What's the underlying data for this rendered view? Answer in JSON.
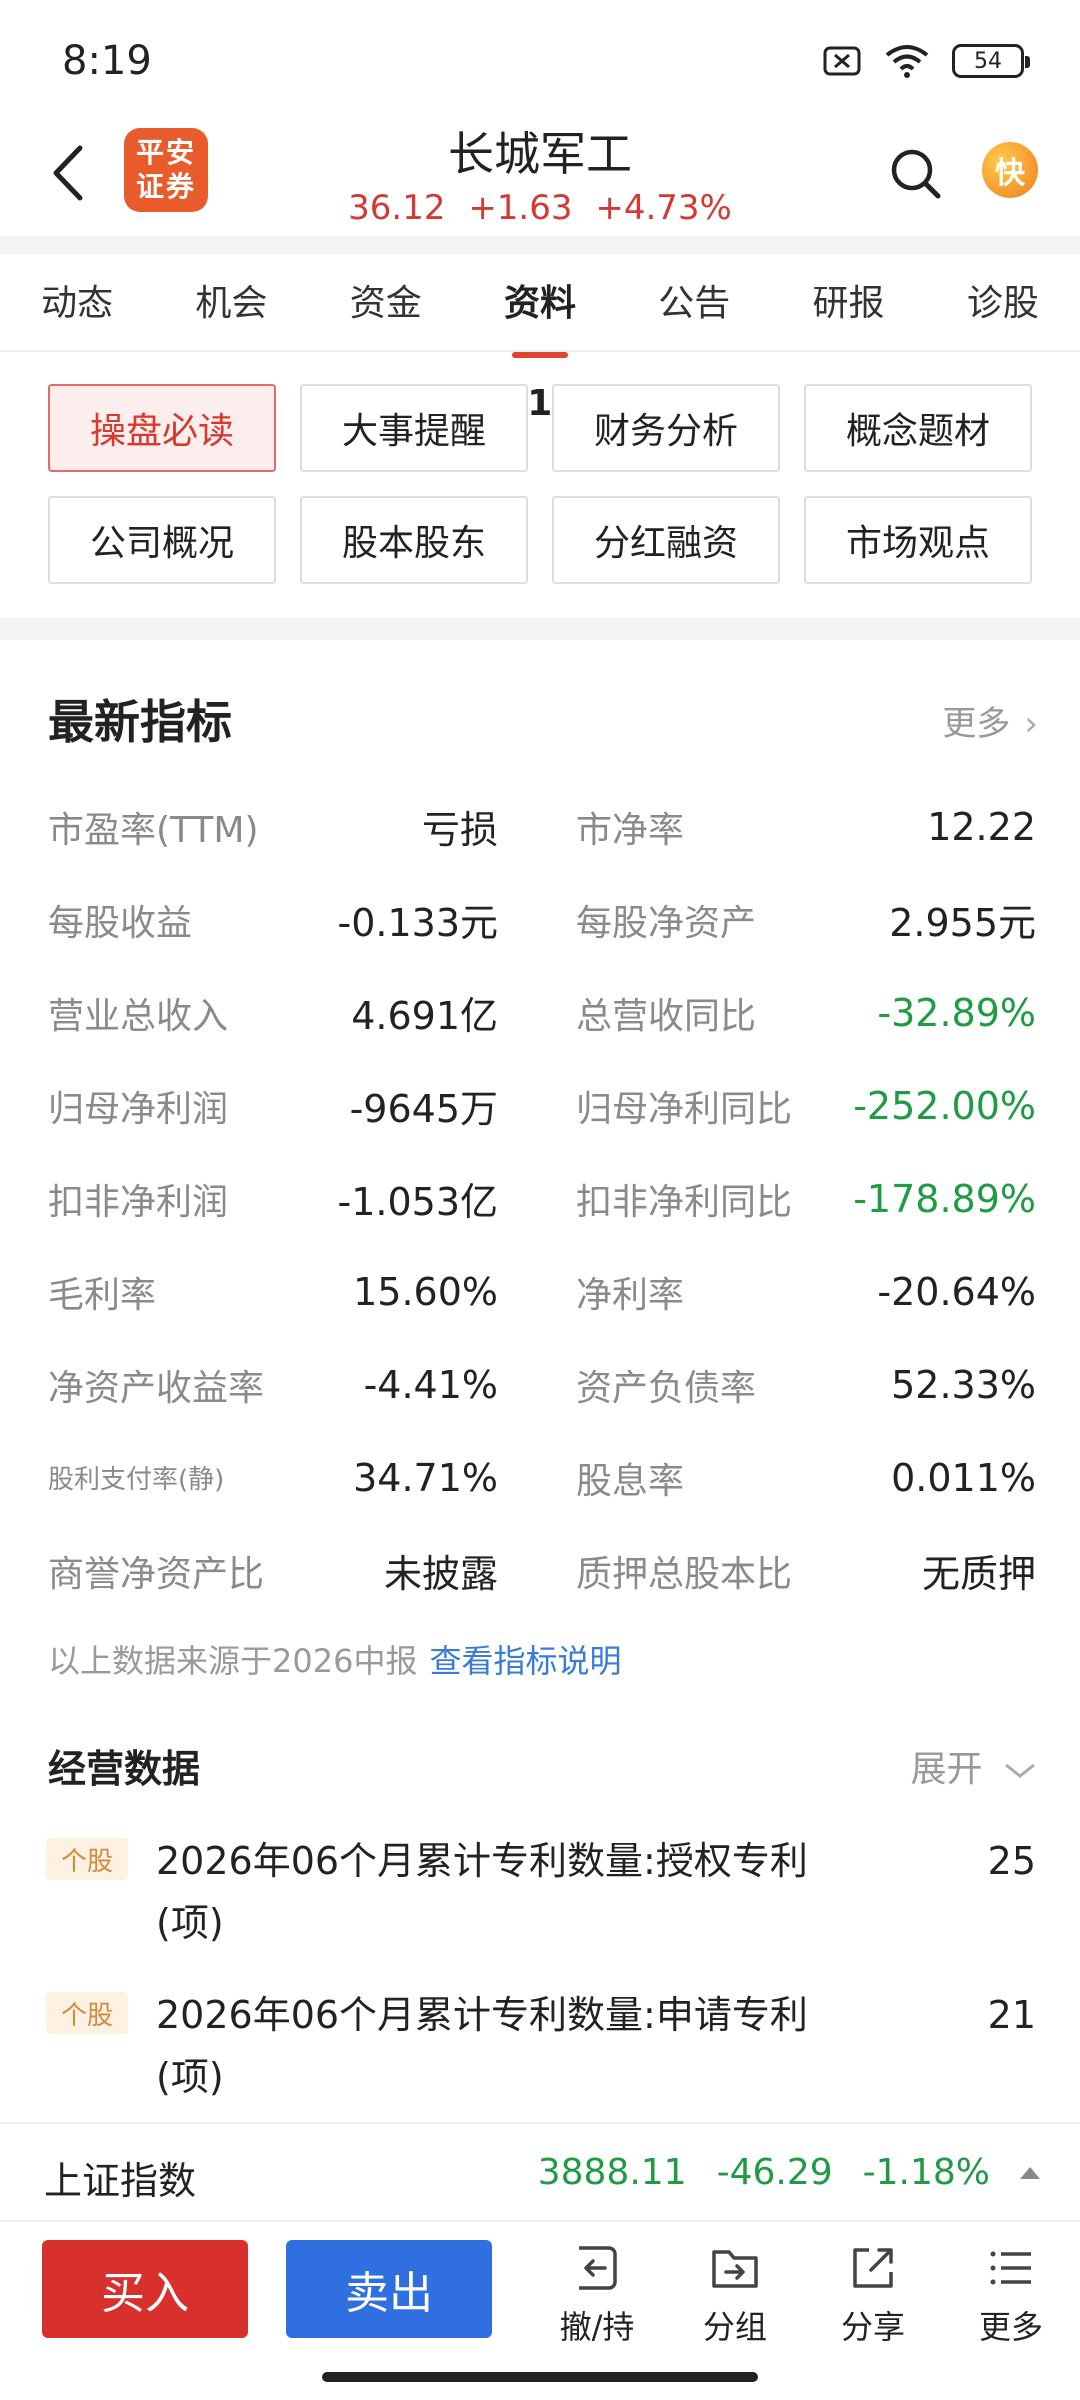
{
  "status_bar": {
    "time": "8:19",
    "battery": "54"
  },
  "header": {
    "brand_line1": "平安",
    "brand_line2": "证券",
    "stock_name": "长城军工",
    "price": "36.12",
    "change": "+1.63",
    "change_pct": "+4.73%",
    "kuai_label": "快"
  },
  "tabs": [
    {
      "label": "动态"
    },
    {
      "label": "机会"
    },
    {
      "label": "资金"
    },
    {
      "label": "资料(F10)",
      "active": true
    },
    {
      "label": "公告"
    },
    {
      "label": "研报"
    },
    {
      "label": "诊股"
    }
  ],
  "quick_buttons": [
    {
      "label": "操盘必读",
      "active": true
    },
    {
      "label": "大事提醒"
    },
    {
      "label": "财务分析"
    },
    {
      "label": "概念题材"
    },
    {
      "label": "公司概况"
    },
    {
      "label": "股本股东"
    },
    {
      "label": "分红融资"
    },
    {
      "label": "市场观点"
    }
  ],
  "latest": {
    "title": "最新指标",
    "more": "更多",
    "rows": [
      {
        "l_label": "市盈率(TTM)",
        "l_value": "亏损",
        "r_label": "市净率",
        "r_value": "12.22"
      },
      {
        "l_label": "每股收益",
        "l_value": "-0.133元",
        "r_label": "每股净资产",
        "r_value": "2.955元"
      },
      {
        "l_label": "营业总收入",
        "l_value": "4.691亿",
        "r_label": "总营收同比",
        "r_value": "-32.89%"
      },
      {
        "l_label": "归母净利润",
        "l_value": "-9645万",
        "r_label": "归母净利同比",
        "r_value": "-252.00%"
      },
      {
        "l_label": "扣非净利润",
        "l_value": "-1.053亿",
        "r_label": "扣非净利同比",
        "r_value": "-178.89%"
      },
      {
        "l_label": "毛利率",
        "l_value": "15.60%",
        "r_label": "净利率",
        "r_value": "-20.64%"
      },
      {
        "l_label": "净资产收益率",
        "l_value": "-4.41%",
        "r_label": "资产负债率",
        "r_value": "52.33%"
      },
      {
        "l_label": "股利支付率(静)",
        "l_value": "34.71%",
        "r_label": "股息率",
        "r_value": "0.011%"
      },
      {
        "l_label": "商誉净资产比",
        "l_value": "未披露",
        "r_label": "质押总股本比",
        "r_value": "无质押"
      }
    ],
    "source_text": "以上数据来源于2026中报",
    "source_link": "查看指标说明"
  },
  "operating": {
    "title": "经营数据",
    "expand": "展开",
    "items": [
      {
        "tag": "个股",
        "text": "2026年06个月累计专利数量:授权专利(项)",
        "value": "25"
      },
      {
        "tag": "个股",
        "text": "2026年06个月累计专利数量:申请专利(项)",
        "value": "21"
      }
    ]
  },
  "index_bar": {
    "name": "上证指数",
    "value": "3888.11",
    "change": "-46.29",
    "change_pct": "-1.18%"
  },
  "actions": {
    "buy": "买入",
    "sell": "卖出",
    "cancel_hold": "撤/持",
    "group": "分组",
    "share": "分享",
    "more": "更多"
  },
  "colors": {
    "up_red": "#d23a33",
    "down_green": "#1f9b44",
    "buy_red": "#d8302d",
    "sell_blue": "#2f6fe0",
    "accent": "#e2422f"
  }
}
